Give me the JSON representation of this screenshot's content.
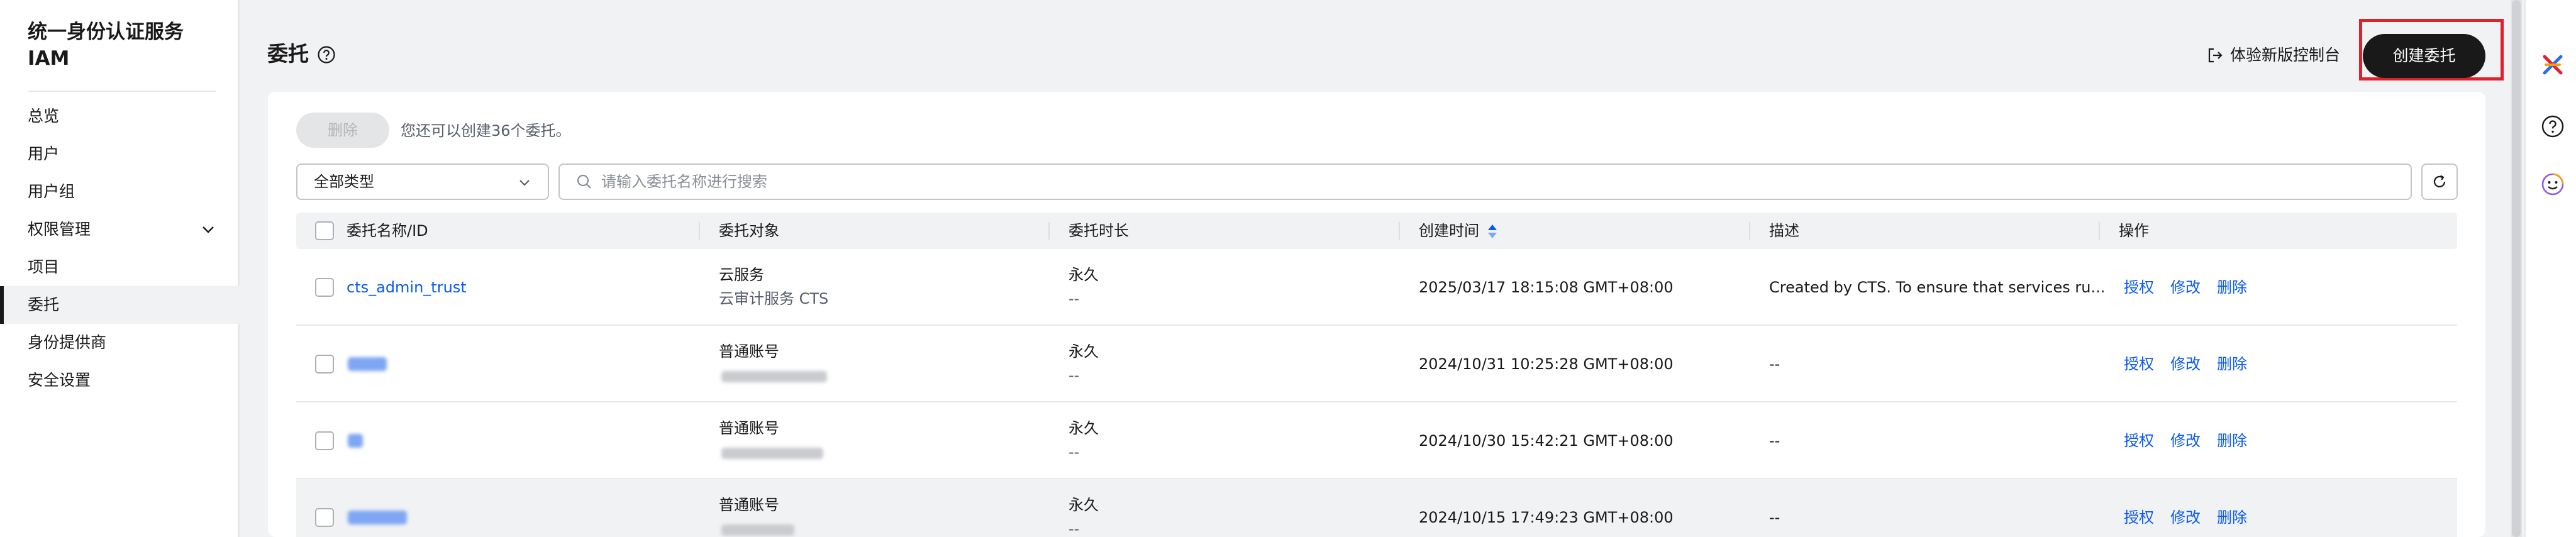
{
  "app": {
    "title": "统一身份认证服务 IAM"
  },
  "sidebar": {
    "items": [
      {
        "label": "总览"
      },
      {
        "label": "用户"
      },
      {
        "label": "用户组"
      },
      {
        "label": "权限管理"
      },
      {
        "label": "项目"
      },
      {
        "label": "委托",
        "active": true
      },
      {
        "label": "身份提供商"
      },
      {
        "label": "安全设置"
      }
    ]
  },
  "header": {
    "title": "委托",
    "new_console": "体验新版控制台",
    "create_button": "创建委托"
  },
  "toolbar": {
    "delete_button": "删除",
    "quota_text": "您还可以创建36个委托。",
    "type_select": "全部类型",
    "search_placeholder": "请输入委托名称进行搜索"
  },
  "table": {
    "columns": [
      "委托名称/ID",
      "委托对象",
      "委托时长",
      "创建时间",
      "描述",
      "操作"
    ],
    "rows": [
      {
        "name": "cts_admin_trust",
        "target": "云服务",
        "target_sub": "云审计服务 CTS",
        "duration": "永久",
        "duration_sub": "--",
        "created": "2025/03/17 18:15:08 GMT+08:00",
        "description": "Created by CTS. To ensure that services ru...",
        "ops": [
          "授权",
          "修改",
          "删除"
        ]
      },
      {
        "name": "",
        "target": "普通账号",
        "target_sub": "",
        "duration": "永久",
        "duration_sub": "--",
        "created": "2024/10/31 10:25:28 GMT+08:00",
        "description": "--",
        "ops": [
          "授权",
          "修改",
          "删除"
        ]
      },
      {
        "name": "",
        "target": "普通账号",
        "target_sub": "",
        "duration": "永久",
        "duration_sub": "--",
        "created": "2024/10/30 15:42:21 GMT+08:00",
        "description": "--",
        "ops": [
          "授权",
          "修改",
          "删除"
        ]
      },
      {
        "name": "",
        "target": "普通账号",
        "target_sub": "",
        "duration": "永久",
        "duration_sub": "--",
        "created": "2024/10/15 17:49:23 GMT+08:00",
        "description": "--",
        "ops": [
          "授权",
          "修改",
          "删除"
        ]
      }
    ]
  },
  "colors": {
    "accent": "#0a59f7",
    "primary_button": "#191919",
    "highlight": "#e0202a"
  },
  "rail": {
    "icons": [
      "brand-icon",
      "help-icon",
      "smiley-icon"
    ]
  }
}
